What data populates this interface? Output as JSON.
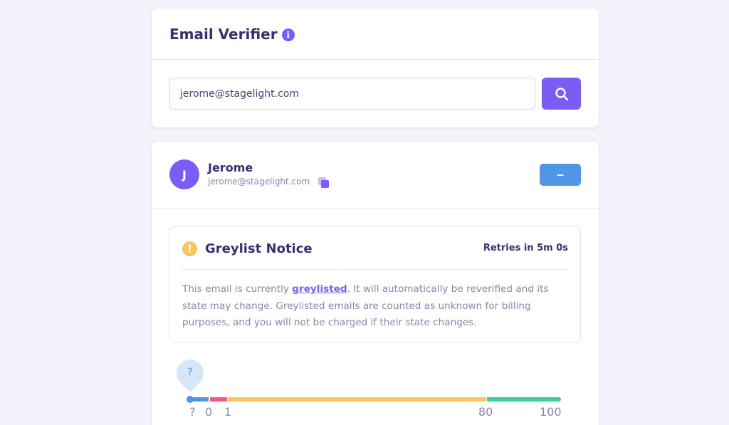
{
  "verifier": {
    "title": "Email Verifier",
    "info_icon": "info-icon",
    "email_value": "jerome@stagelight.com",
    "search_icon": "search-icon"
  },
  "result": {
    "avatar_initial": "J",
    "name": "Jerome",
    "email": "jerome@stagelight.com",
    "copy_icon": "copy-icon",
    "collapse_label": "–"
  },
  "notice": {
    "icon": "warning-icon",
    "icon_glyph": "!",
    "title": "Greylist Notice",
    "retry": "Retries in 5m 0s",
    "body_prefix": "This email is currently ",
    "body_link": "greylisted",
    "body_suffix": ". It will automatically be reverified and its state may change. Greylisted emails are counted as unknown for billing purposes, and you will not be charged if their state changes."
  },
  "score": {
    "current": "?",
    "ticks": [
      "?",
      "0",
      "1",
      "80",
      "100"
    ],
    "colors": {
      "unknown": "#4f96e6",
      "low": "#f7577b",
      "medium": "#fdc55e",
      "high": "#3ccf8e"
    }
  },
  "colors": {
    "accent": "#7b5cf5",
    "button_blue": "#4f96e6",
    "background": "#f3f3fb"
  }
}
